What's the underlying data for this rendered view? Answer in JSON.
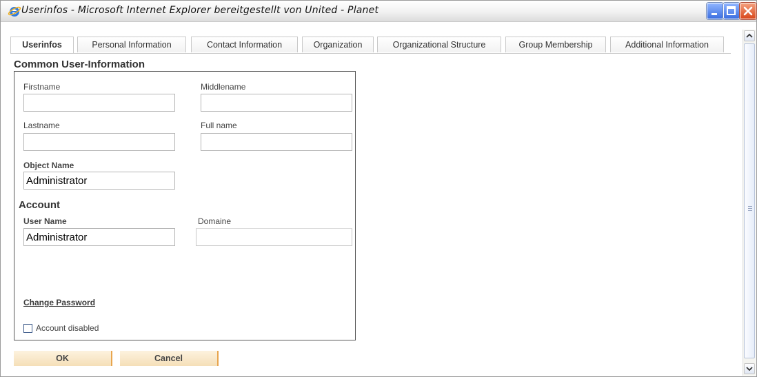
{
  "window": {
    "title": "Userinfos - Microsoft Internet Explorer bereitgestellt von United - Planet",
    "controls": {
      "minimize": "minimize-icon",
      "maximize": "maximize-icon",
      "close": "close-icon"
    },
    "browser_icon": "internet-explorer-icon"
  },
  "tabs": [
    {
      "label": "Userinfos",
      "active": true
    },
    {
      "label": "Personal Information",
      "active": false
    },
    {
      "label": "Contact Information",
      "active": false
    },
    {
      "label": "Organization",
      "active": false
    },
    {
      "label": "Organizational Structure",
      "active": false
    },
    {
      "label": "Group Membership",
      "active": false
    },
    {
      "label": "Additional Information",
      "active": false
    }
  ],
  "common": {
    "heading": "Common User-Information",
    "firstname": {
      "label": "Firstname",
      "value": ""
    },
    "middlename": {
      "label": "Middlename",
      "value": ""
    },
    "lastname": {
      "label": "Lastname",
      "value": ""
    },
    "fullname": {
      "label": "Full name",
      "value": ""
    },
    "objectname": {
      "label": "Object Name",
      "value": "Administrator"
    }
  },
  "account": {
    "heading": "Account",
    "username": {
      "label": "User Name",
      "value": "Administrator"
    },
    "domain": {
      "label": "Domaine",
      "value": ""
    },
    "change_password": "Change Password",
    "disabled": {
      "label": "Account disabled",
      "checked": false
    }
  },
  "buttons": {
    "ok": "OK",
    "cancel": "Cancel"
  },
  "colors": {
    "button_bg": "#f8e6c4",
    "button_accent": "#e8a54e",
    "titlebar": "#efefef",
    "close_button": "#d9481c"
  }
}
